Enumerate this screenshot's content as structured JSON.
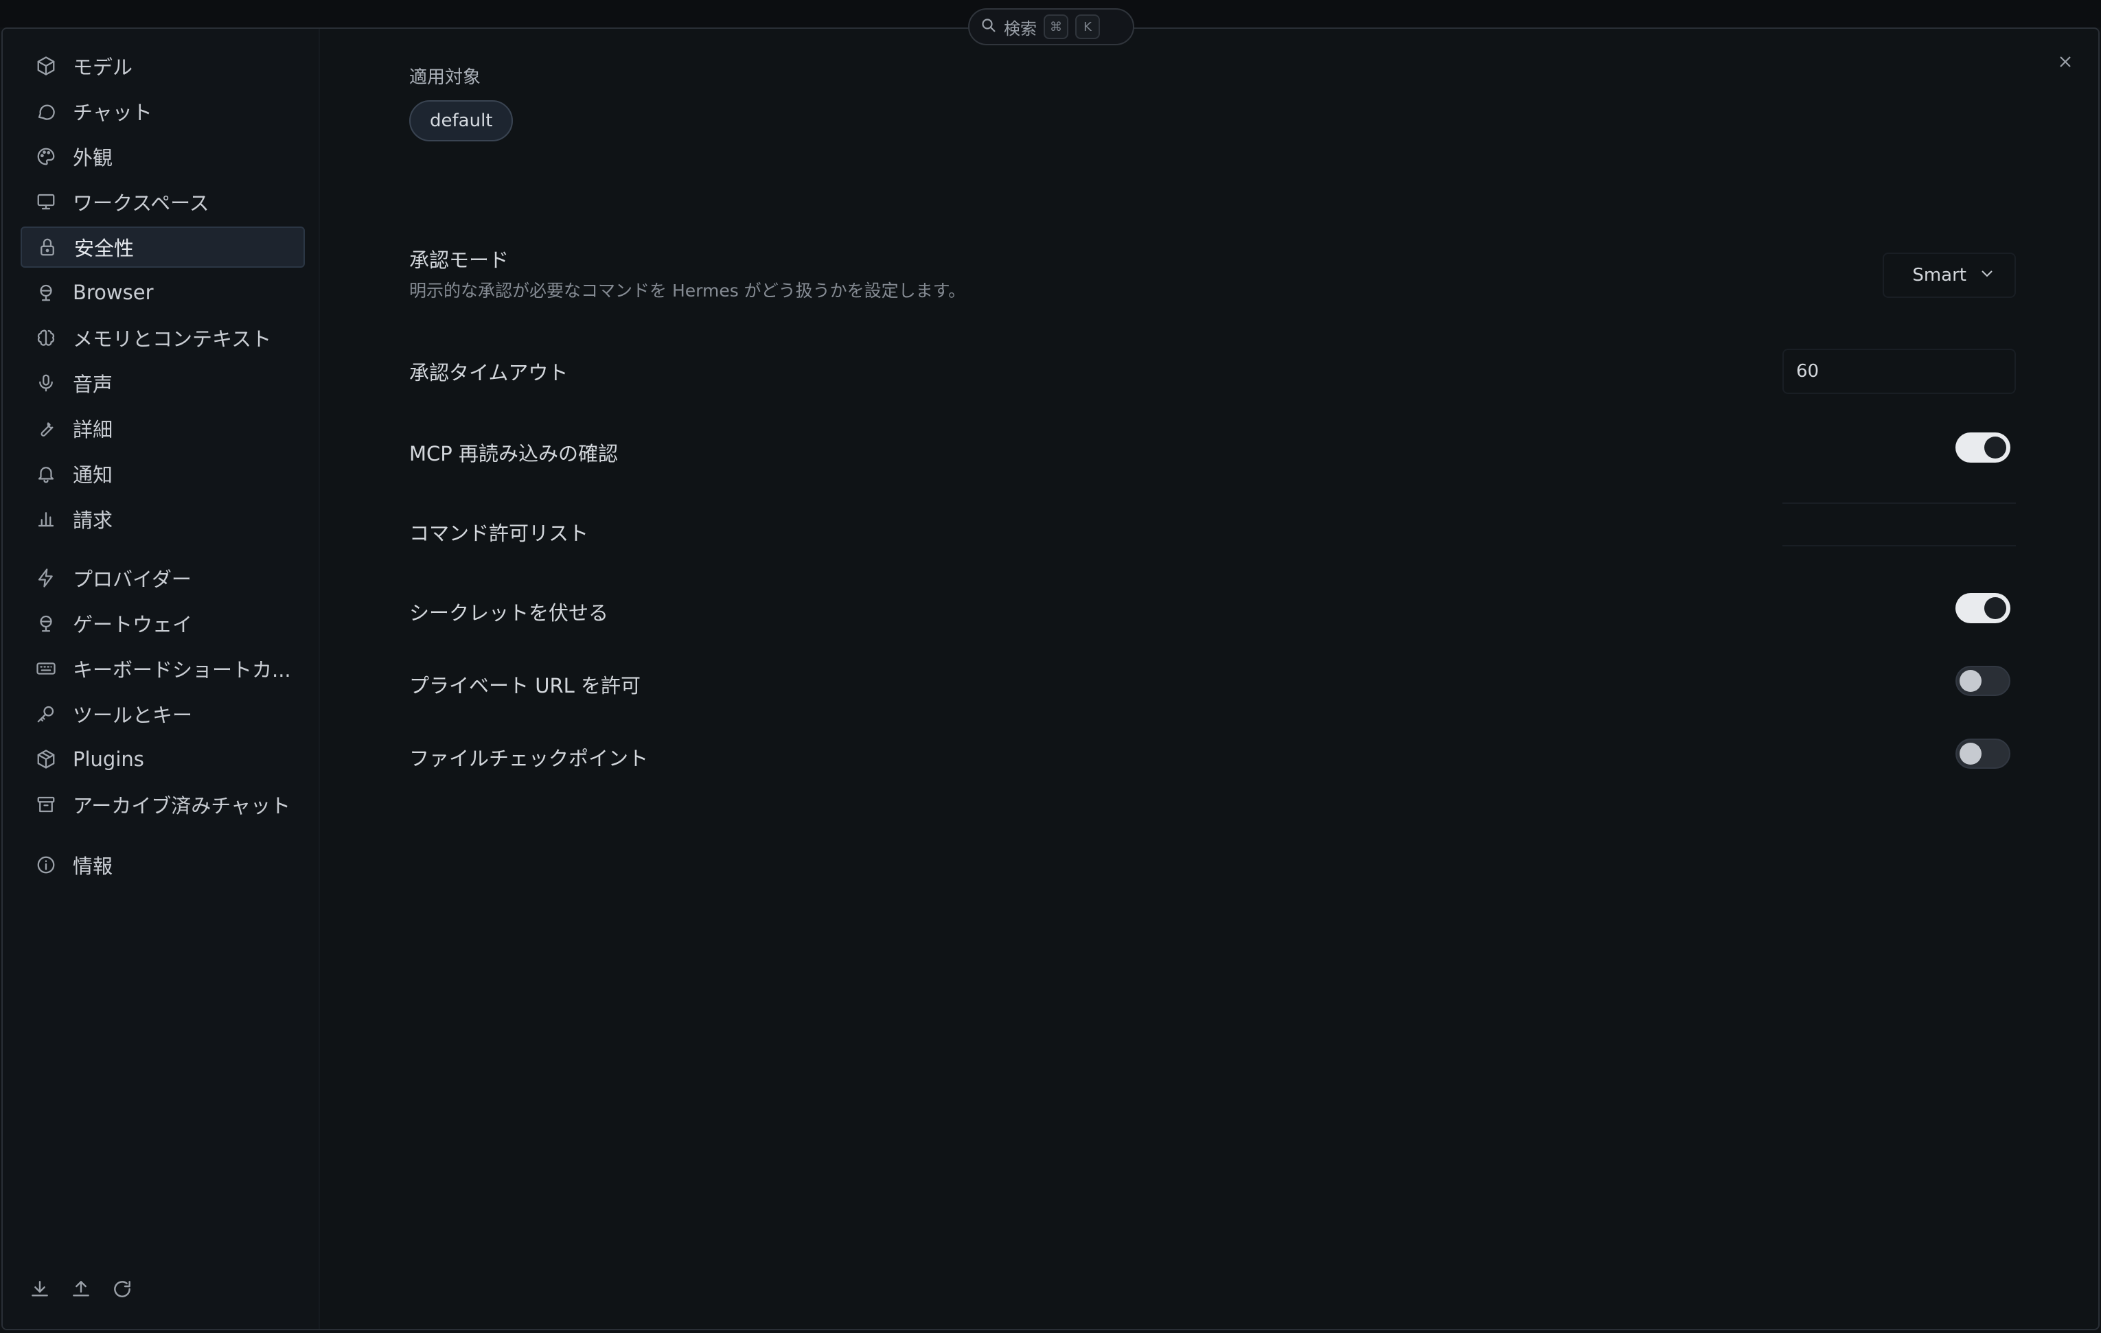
{
  "search": {
    "label": "検索",
    "key1": "⌘",
    "key2": "K"
  },
  "sidebar": {
    "items": [
      {
        "label": "モデル",
        "icon": "cube-icon"
      },
      {
        "label": "チャット",
        "icon": "chat-bubble-icon"
      },
      {
        "label": "外観",
        "icon": "palette-icon"
      },
      {
        "label": "ワークスペース",
        "icon": "monitor-icon"
      },
      {
        "label": "安全性",
        "icon": "lock-icon",
        "active": true
      },
      {
        "label": "Browser",
        "icon": "globe-icon"
      },
      {
        "label": "メモリとコンテキスト",
        "icon": "brain-icon"
      },
      {
        "label": "音声",
        "icon": "microphone-icon"
      },
      {
        "label": "詳細",
        "icon": "wrench-icon"
      },
      {
        "label": "通知",
        "icon": "bell-icon"
      },
      {
        "label": "請求",
        "icon": "bar-chart-icon"
      },
      {
        "label": "プロバイダー",
        "icon": "lightning-icon"
      },
      {
        "label": "ゲートウェイ",
        "icon": "globe-icon"
      },
      {
        "label": "キーボードショートカ...",
        "icon": "keyboard-icon"
      },
      {
        "label": "ツールとキー",
        "icon": "key-icon"
      },
      {
        "label": "Plugins",
        "icon": "package-icon"
      },
      {
        "label": "アーカイブ済みチャット",
        "icon": "archive-icon"
      },
      {
        "label": "情報",
        "icon": "info-icon"
      }
    ],
    "footer_icons": [
      "download-icon",
      "upload-icon",
      "refresh-icon"
    ]
  },
  "main": {
    "applies_to_label": "適用対象",
    "applies_to_chip": "default",
    "approval_mode": {
      "title": "承認モード",
      "description": "明示的な承認が必要なコマンドを Hermes がどう扱うかを設定します。",
      "value": "Smart"
    },
    "approval_timeout": {
      "title": "承認タイムアウト",
      "value": "60"
    },
    "mcp_reload_confirm": {
      "title": "MCP 再読み込みの確認",
      "enabled": true
    },
    "command_allowlist": {
      "title": "コマンド許可リスト",
      "value": ""
    },
    "mask_secrets": {
      "title": "シークレットを伏せる",
      "enabled": true
    },
    "allow_private_url": {
      "title": "プライベート URL を許可",
      "enabled": false
    },
    "file_checkpoints": {
      "title": "ファイルチェックポイント",
      "enabled": false
    }
  }
}
